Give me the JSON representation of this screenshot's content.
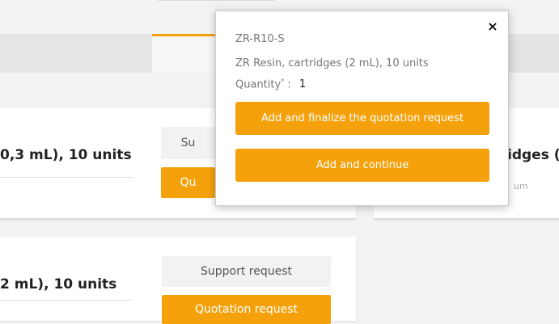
{
  "cards": [
    {
      "title": "0,3 mL), 10 units",
      "support_label": "Su",
      "quote_label": "Qu"
    },
    {
      "title": "2 mL), 10 units",
      "support_label": "Support request",
      "quote_label": "Quotation request"
    },
    {
      "title": "idges (",
      "sub": "um"
    }
  ],
  "popup": {
    "sku": "ZR-R10-S",
    "description": "ZR Resin, cartridges (2 mL), 10 units",
    "quantity_label": "Quantity",
    "required_mark": "*",
    "quantity_separator": ":",
    "quantity_value": "1",
    "finalize_label": "Add and finalize the quotation request",
    "continue_label": "Add and continue",
    "close_symbol": "×"
  },
  "colors": {
    "accent": "#f4a10c",
    "background": "#f3f3f3"
  }
}
